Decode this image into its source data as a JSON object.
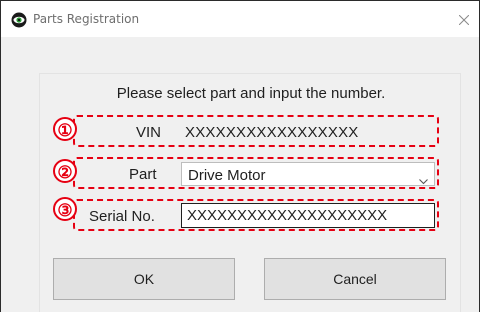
{
  "window": {
    "title": "Parts Registration"
  },
  "form": {
    "instruction": "Please select part and input the number.",
    "markers": [
      "①",
      "②",
      "③"
    ],
    "vin": {
      "label": "VIN",
      "value": "XXXXXXXXXXXXXXXXX"
    },
    "part": {
      "label": "Part",
      "selected": "Drive Motor"
    },
    "serial": {
      "label": "Serial No.",
      "value": "XXXXXXXXXXXXXXXXXXXX"
    }
  },
  "buttons": {
    "ok": "OK",
    "cancel": "Cancel"
  },
  "colors": {
    "annotation": "#e60012",
    "dialog_bg": "#f0f0f0",
    "button_bg": "#e1e1e1"
  },
  "icons": {
    "app": "app-eye-icon",
    "close": "close-icon",
    "dropdown": "chevron-down-icon"
  }
}
